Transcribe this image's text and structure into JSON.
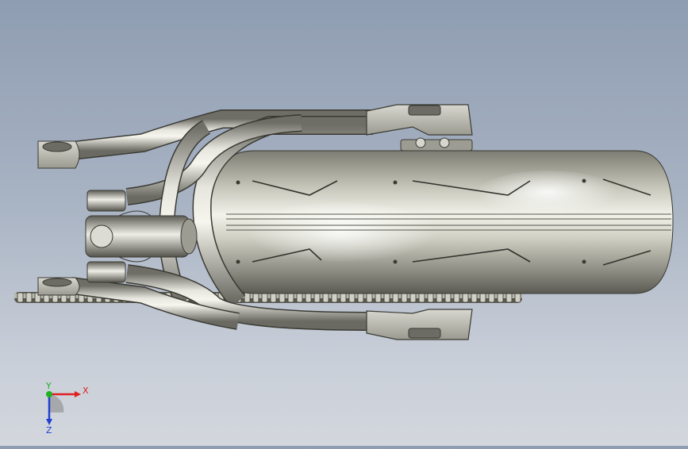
{
  "viewport": {
    "background_top": "#8f9db2",
    "background_bottom": "#d3d7dd"
  },
  "model": {
    "metal_color": "#bcbcb4",
    "tire_color": "#c8c8bc",
    "shadow_color": "#3a3a34"
  },
  "triad": {
    "x_label": "X",
    "y_label": "Y",
    "z_label": "Z",
    "x_color": "#e02020",
    "y_color": "#20b020",
    "z_color": "#2040d0"
  }
}
